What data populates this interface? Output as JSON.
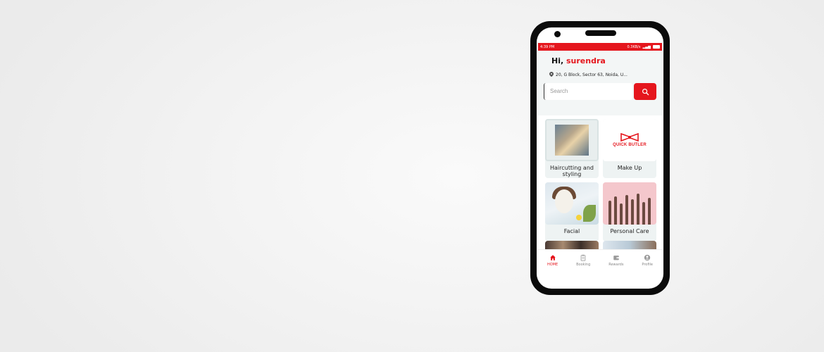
{
  "status_bar": {
    "time": "4:39 PM",
    "network_speed": "0.3KB/s"
  },
  "greeting": {
    "prefix": "Hi,",
    "name": "surendra"
  },
  "location": {
    "address": "20, G Block, Sector 63, Noida, U..."
  },
  "search": {
    "placeholder": "Search",
    "button_icon": "search-icon"
  },
  "categories": [
    {
      "label": "Haircutting and styling"
    },
    {
      "label": "Make Up",
      "image_text": "QUICK BUTLER"
    },
    {
      "label": "Facial"
    },
    {
      "label": "Personal Care"
    }
  ],
  "bottom_nav": {
    "items": [
      {
        "label": "HOME",
        "icon": "home-icon",
        "active": true
      },
      {
        "label": "Booking",
        "icon": "clipboard-icon",
        "active": false
      },
      {
        "label": "Rewards",
        "icon": "wallet-icon",
        "active": false
      },
      {
        "label": "Profile",
        "icon": "user-icon",
        "active": false
      }
    ]
  },
  "colors": {
    "accent": "#e5161d",
    "header_bg": "#f3f6f6",
    "card_bg": "#eef3f3"
  }
}
